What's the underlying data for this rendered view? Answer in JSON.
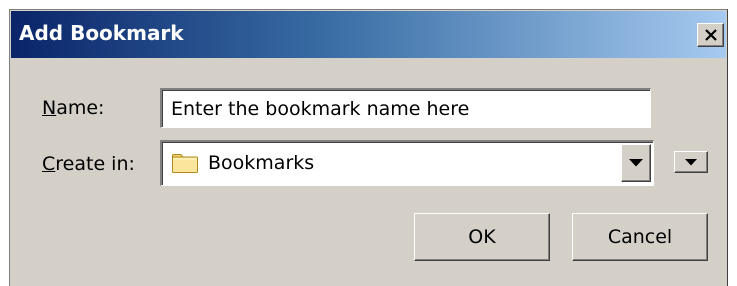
{
  "dialog": {
    "title": "Add Bookmark",
    "close_icon": "close-x-icon"
  },
  "name_field": {
    "label_mnemonic": "N",
    "label_rest": "ame:",
    "value": "Enter the bookmark name here"
  },
  "create_in": {
    "label_mnemonic": "C",
    "label_rest": "reate in:",
    "selected": "Bookmarks",
    "folder_icon": "folder-icon",
    "dropdown_icon": "chevron-down-icon",
    "expand_icon": "chevron-down-icon"
  },
  "buttons": {
    "ok": "OK",
    "cancel": "Cancel"
  },
  "colors": {
    "titlebar_start": "#0a246a",
    "titlebar_end": "#a6caf0",
    "face": "#d4d0c8"
  }
}
